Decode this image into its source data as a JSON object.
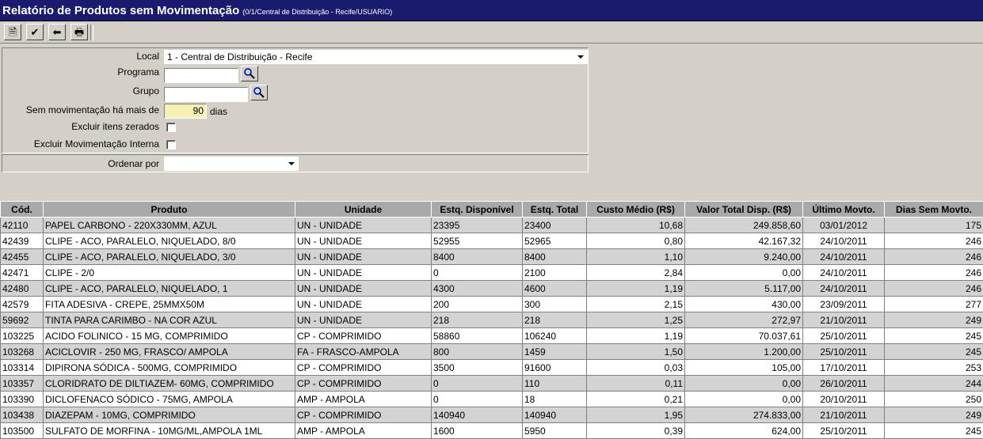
{
  "window": {
    "title": "Relatório de Produtos sem Movimentação",
    "subtitle": "(0/1/Central de Distribuição - Recife/USUARIO)"
  },
  "toolbar": {
    "buttons": [
      {
        "name": "new-report-icon",
        "glyph": "🗎"
      },
      {
        "name": "confirm-icon",
        "glyph": "✔"
      },
      {
        "name": "back-icon",
        "glyph": "⬅"
      },
      {
        "name": "print-icon",
        "glyph": "🖶"
      }
    ]
  },
  "filters": {
    "local_label": "Local",
    "local_value": "1 - Central de Distribuição - Recife",
    "programa_label": "Programa",
    "programa_value": "",
    "grupo_label": "Grupo",
    "grupo_value": "",
    "sem_mov_label": "Sem movimentação há mais de",
    "sem_mov_value": "90",
    "sem_mov_unit": "dias",
    "excluir_zerados_label": "Excluir itens zerados",
    "excluir_zerados_checked": false,
    "excluir_interna_label": "Excluir Movimentação Interna",
    "excluir_interna_checked": false,
    "ordenar_label": "Ordenar por",
    "ordenar_value": ""
  },
  "colors": {
    "title_bg": "#1a1a6e",
    "window_bg": "#d4d0c8",
    "header_bg": "#a9a9a9",
    "row_alt_bg": "#d3d3d3",
    "highlight_input": "#f5f0b4"
  },
  "table": {
    "headers": [
      "Cód.",
      "Produto",
      "Unidade",
      "Estq. Disponível",
      "Estq. Total",
      "Custo Médio (R$)",
      "Valor Total Disp. (R$)",
      "Último Movto.",
      "Dias Sem Movto."
    ],
    "rows": [
      [
        "42110",
        "PAPEL CARBONO - 220X330MM, AZUL",
        "UN - UNIDADE",
        "23395",
        "23400",
        "10,68",
        "249.858,60",
        "03/01/2012",
        "175"
      ],
      [
        "42439",
        "CLIPE - ACO, PARALELO, NIQUELADO, 8/0",
        "UN - UNIDADE",
        "52955",
        "52965",
        "0,80",
        "42.167,32",
        "24/10/2011",
        "246"
      ],
      [
        "42455",
        "CLIPE - ACO, PARALELO, NIQUELADO, 3/0",
        "UN - UNIDADE",
        "8400",
        "8400",
        "1,10",
        "9.240,00",
        "24/10/2011",
        "246"
      ],
      [
        "42471",
        "CLIPE - 2/0",
        "UN - UNIDADE",
        "0",
        "2100",
        "2,84",
        "0,00",
        "24/10/2011",
        "246"
      ],
      [
        "42480",
        "CLIPE - ACO, PARALELO, NIQUELADO, 1",
        "UN - UNIDADE",
        "4300",
        "4600",
        "1,19",
        "5.117,00",
        "24/10/2011",
        "246"
      ],
      [
        "42579",
        "FITA ADESIVA - CREPE, 25MMX50M",
        "UN - UNIDADE",
        "200",
        "300",
        "2,15",
        "430,00",
        "23/09/2011",
        "277"
      ],
      [
        "59692",
        "TINTA PARA CARIMBO - NA COR AZUL",
        "UN - UNIDADE",
        "218",
        "218",
        "1,25",
        "272,97",
        "21/10/2011",
        "249"
      ],
      [
        "103225",
        "ACIDO FOLINICO - 15 MG, COMPRIMIDO",
        "CP - COMPRIMIDO",
        "58860",
        "106240",
        "1,19",
        "70.037,61",
        "25/10/2011",
        "245"
      ],
      [
        "103268",
        "ACICLOVIR - 250 MG, FRASCO/ AMPOLA",
        "FA - FRASCO-AMPOLA",
        "800",
        "1459",
        "1,50",
        "1.200,00",
        "25/10/2011",
        "245"
      ],
      [
        "103314",
        "DIPIRONA SÓDICA - 500MG, COMPRIMIDO",
        "CP - COMPRIMIDO",
        "3500",
        "91600",
        "0,03",
        "105,00",
        "17/10/2011",
        "253"
      ],
      [
        "103357",
        "CLORIDRATO DE DILTIAZEM- 60MG, COMPRIMIDO",
        "CP - COMPRIMIDO",
        "0",
        "110",
        "0,11",
        "0,00",
        "26/10/2011",
        "244"
      ],
      [
        "103390",
        "DICLOFENACO SÓDICO - 75MG, AMPOLA",
        "AMP - AMPOLA",
        "0",
        "18",
        "0,21",
        "0,00",
        "20/10/2011",
        "250"
      ],
      [
        "103438",
        "DIAZEPAM - 10MG, COMPRIMIDO",
        "CP - COMPRIMIDO",
        "140940",
        "140940",
        "1,95",
        "274.833,00",
        "21/10/2011",
        "249"
      ],
      [
        "103500",
        "SULFATO DE MORFINA - 10MG/ML,AMPOLA 1ML",
        "AMP - AMPOLA",
        "1600",
        "5950",
        "0,39",
        "624,00",
        "25/10/2011",
        "245"
      ]
    ]
  }
}
